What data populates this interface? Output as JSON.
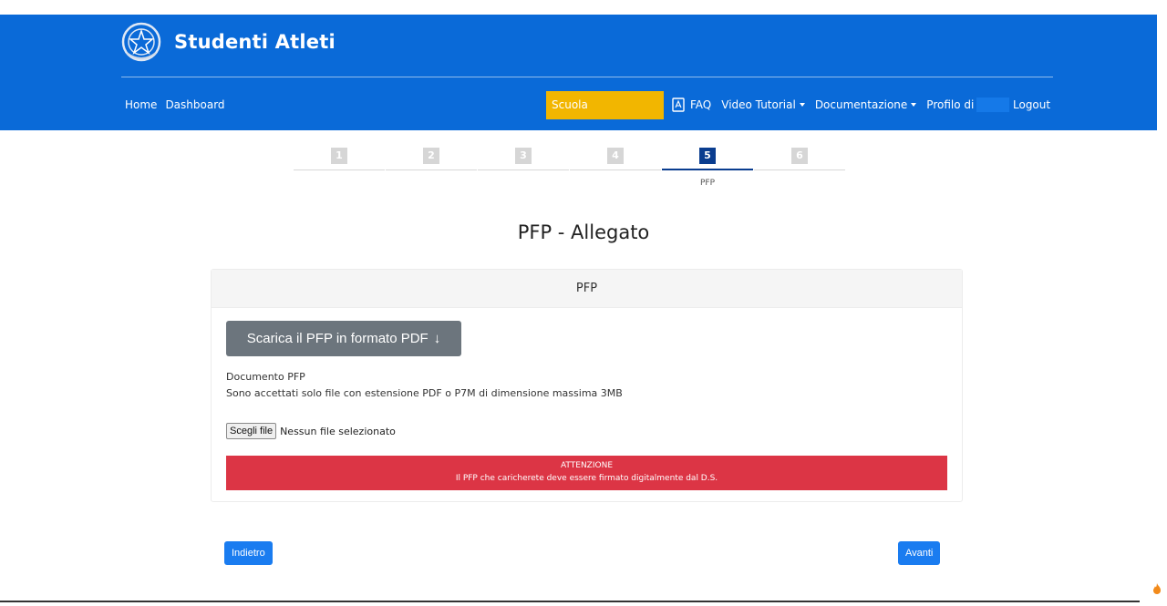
{
  "header": {
    "brand_title": "Studenti Atleti",
    "nav_left": [
      "Home",
      "Dashboard"
    ],
    "scuola": "Scuola",
    "faq": "FAQ",
    "video_tutorial": "Video Tutorial",
    "documentazione": "Documentazione",
    "profilo": "Profilo di",
    "logout": "Logout",
    "colors": {
      "bar": "#0a6ad8",
      "scuola": "#f2b600"
    }
  },
  "stepper": {
    "active_step": 5,
    "steps": [
      {
        "num": "1",
        "label": ""
      },
      {
        "num": "2",
        "label": ""
      },
      {
        "num": "3",
        "label": ""
      },
      {
        "num": "4",
        "label": ""
      },
      {
        "num": "5",
        "label": "PFP"
      },
      {
        "num": "6",
        "label": ""
      }
    ]
  },
  "page_title": "PFP - Allegato",
  "card": {
    "header": "PFP",
    "download_button": "Scarica il PFP in formato PDF",
    "doc_label": "Documento PFP",
    "doc_note": "Sono accettati solo file con estensione PDF o P7M di dimensione massima 3MB",
    "choose_file": "Scegli file",
    "file_status": "Nessun file selezionato",
    "alert_title": "ATTENZIONE",
    "alert_text": "Il PFP che caricherete deve essere firmato digitalmente dal D.S."
  },
  "buttons": {
    "back": "Indietro",
    "next": "Avanti"
  }
}
